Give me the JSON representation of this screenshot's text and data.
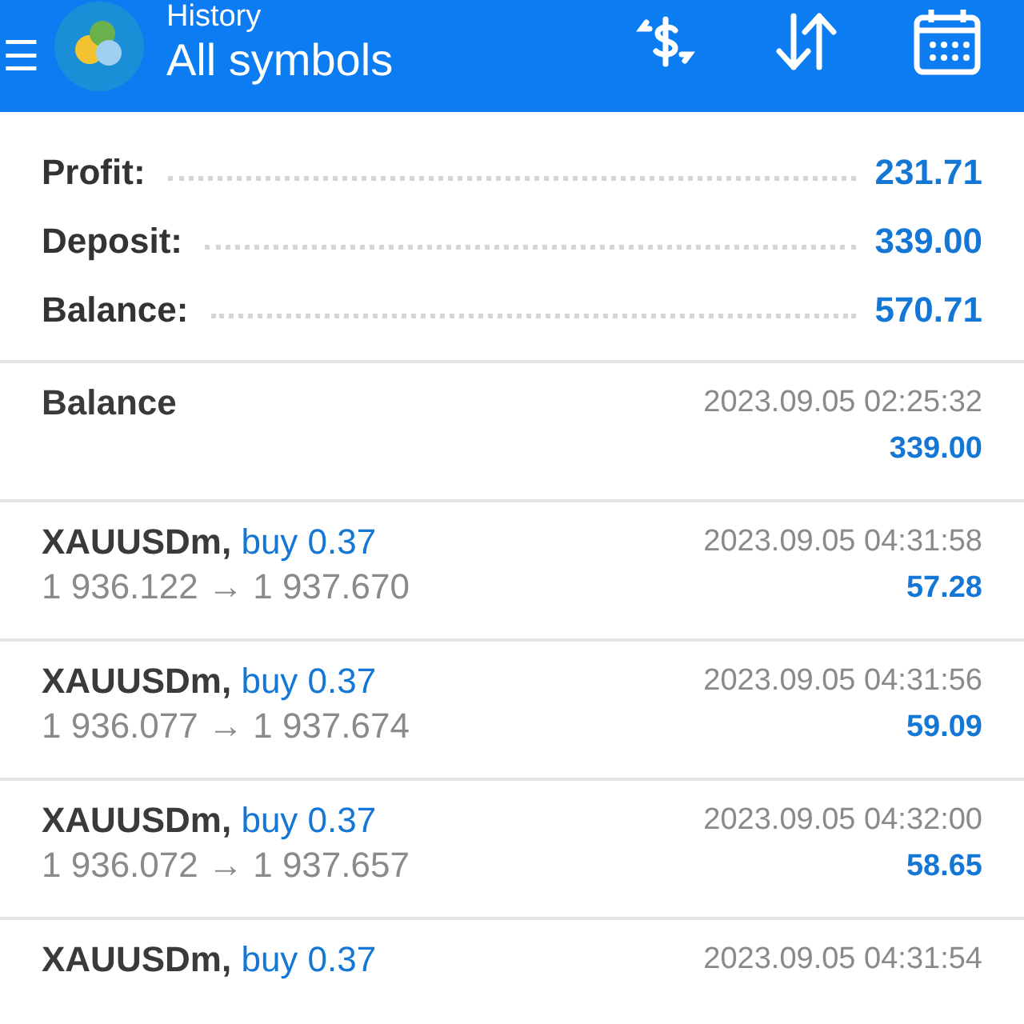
{
  "header": {
    "menu_icon": "☰",
    "subtitle": "History",
    "title": "All symbols"
  },
  "summary": [
    {
      "label": "Profit:",
      "value": "231.71"
    },
    {
      "label": "Deposit:",
      "value": "339.00"
    },
    {
      "label": "Balance:",
      "value": "570.71"
    }
  ],
  "deals": [
    {
      "kind": "balance",
      "title": "Balance",
      "time": "2023.09.05 02:25:32",
      "amount": "339.00"
    },
    {
      "kind": "trade",
      "symbol": "XAUUSDm,",
      "side": "buy 0.37",
      "prices": "1 936.122 → 1 937.670",
      "time": "2023.09.05 04:31:58",
      "amount": "57.28"
    },
    {
      "kind": "trade",
      "symbol": "XAUUSDm,",
      "side": "buy 0.37",
      "prices": "1 936.077 → 1 937.674",
      "time": "2023.09.05 04:31:56",
      "amount": "59.09"
    },
    {
      "kind": "trade",
      "symbol": "XAUUSDm,",
      "side": "buy 0.37",
      "prices": "1 936.072 → 1 937.657",
      "time": "2023.09.05 04:32:00",
      "amount": "58.65"
    },
    {
      "kind": "trade",
      "symbol": "XAUUSDm,",
      "side": "buy 0.37",
      "time": "2023.09.05 04:31:54"
    }
  ]
}
